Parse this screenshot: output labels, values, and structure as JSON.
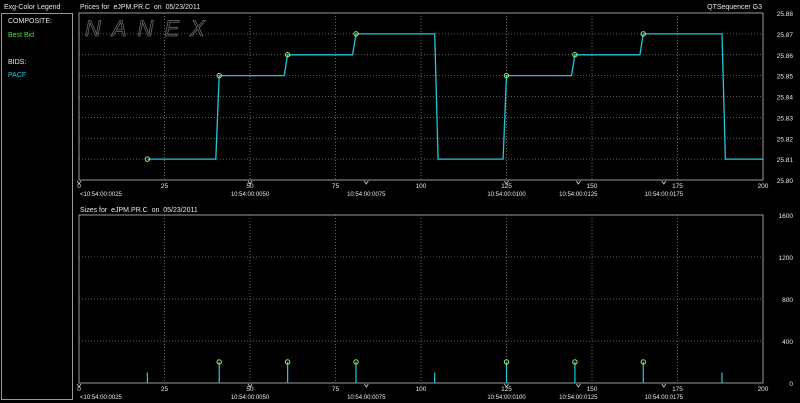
{
  "legend": {
    "title": "Exg-Color Legend",
    "composite_label": "COMPOSITE:",
    "composite_item": "Best Bid",
    "bids_label": "BIDS:",
    "bids_item": "PACF"
  },
  "top_panel": {
    "title": "Prices for  eJPM.PR.C  on  05/23/2011",
    "app_name": "QTSequencer G3",
    "watermark": "NANEX"
  },
  "bottom_panel": {
    "title": "Sizes for  eJPM.PR.C  on  05/23/2011"
  },
  "colors": {
    "line": "#22c8d8",
    "marker": "#a8f060",
    "grid": "#7a7a7a",
    "composite_text": "#40e040",
    "bids_text": "#30c8e0"
  },
  "chart_data": [
    {
      "type": "line",
      "title": "Prices for  eJPM.PR.C  on  05/23/2011",
      "xlim": [
        0,
        200
      ],
      "ylim": [
        25.8,
        25.88
      ],
      "x_ticks": [
        0,
        25,
        50,
        75,
        100,
        125,
        150,
        175,
        200
      ],
      "x_tick_labels": [
        "0",
        "25",
        "50",
        "75",
        "100",
        "125",
        "150",
        "175",
        "200"
      ],
      "y_ticks": [
        25.8,
        25.81,
        25.82,
        25.83,
        25.84,
        25.85,
        25.86,
        25.87,
        25.88
      ],
      "y_tick_labels": [
        "25.80",
        "25.81",
        "25.82",
        "25.83",
        "25.84",
        "25.85",
        "25.86",
        "25.87",
        "25.88"
      ],
      "time_labels": [
        {
          "x": 0,
          "label": "<10:54:00:0025"
        },
        {
          "x": 50,
          "label": "10:54:00:0050"
        },
        {
          "x": 84,
          "label": "10:54:00:0075"
        },
        {
          "x": 125,
          "label": "10:54:00:0100"
        },
        {
          "x": 146,
          "label": "10:54:00:0125"
        },
        {
          "x": 171,
          "label": "10:54:00:0175"
        }
      ],
      "time_markers": [
        0,
        50,
        84,
        125,
        146,
        171
      ],
      "series": [
        {
          "points": [
            [
              20,
              25.81
            ],
            [
              40,
              25.81
            ],
            [
              41,
              25.85
            ],
            [
              60,
              25.85
            ],
            [
              61,
              25.86
            ],
            [
              80,
              25.86
            ],
            [
              81,
              25.87
            ],
            [
              104,
              25.87
            ],
            [
              105,
              25.81
            ],
            [
              124,
              25.81
            ],
            [
              125,
              25.85
            ],
            [
              144,
              25.85
            ],
            [
              145,
              25.86
            ],
            [
              164,
              25.86
            ],
            [
              165,
              25.87
            ],
            [
              188,
              25.87
            ],
            [
              189,
              25.81
            ],
            [
              200,
              25.81
            ]
          ],
          "markers": [
            [
              20,
              25.81
            ],
            [
              41,
              25.85
            ],
            [
              61,
              25.86
            ],
            [
              81,
              25.87
            ],
            [
              125,
              25.85
            ],
            [
              145,
              25.86
            ],
            [
              165,
              25.87
            ]
          ]
        }
      ]
    },
    {
      "type": "bar",
      "title": "Sizes for  eJPM.PR.C  on  05/23/2011",
      "xlim": [
        0,
        200
      ],
      "ylim": [
        0,
        1600
      ],
      "x_ticks": [
        0,
        25,
        50,
        75,
        100,
        125,
        150,
        175,
        200
      ],
      "x_tick_labels": [
        "0",
        "25",
        "50",
        "75",
        "100",
        "125",
        "150",
        "175",
        "200"
      ],
      "y_ticks": [
        0,
        400,
        800,
        1200,
        1600
      ],
      "y_tick_labels": [
        "0",
        "400",
        "800",
        "1200",
        "1600"
      ],
      "time_labels": [
        {
          "x": 0,
          "label": "<10:54:00:0025"
        },
        {
          "x": 50,
          "label": "10:54:00:0050"
        },
        {
          "x": 84,
          "label": "10:54:00:0075"
        },
        {
          "x": 125,
          "label": "10:54:00:0100"
        },
        {
          "x": 146,
          "label": "10:54:00:0125"
        },
        {
          "x": 171,
          "label": "10:54:00:0175"
        }
      ],
      "time_markers": [
        0,
        50,
        84,
        125,
        146,
        171
      ],
      "bars": [
        [
          20,
          100
        ],
        [
          41,
          200
        ],
        [
          61,
          200
        ],
        [
          81,
          200
        ],
        [
          104,
          100
        ],
        [
          125,
          200
        ],
        [
          145,
          200
        ],
        [
          165,
          200
        ],
        [
          188,
          100
        ]
      ],
      "markers": [
        [
          41,
          200
        ],
        [
          61,
          200
        ],
        [
          81,
          200
        ],
        [
          125,
          200
        ],
        [
          145,
          200
        ],
        [
          165,
          200
        ]
      ]
    }
  ]
}
